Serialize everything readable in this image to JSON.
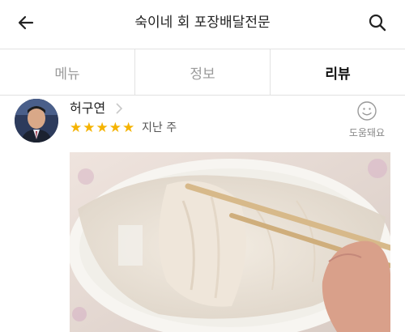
{
  "header": {
    "title": "숙이네 회 포장배달전문",
    "back_icon": "arrow-left-icon",
    "search_icon": "search-icon"
  },
  "tabs": [
    {
      "label": "메뉴",
      "active": false
    },
    {
      "label": "정보",
      "active": false
    },
    {
      "label": "리뷰",
      "active": true
    }
  ],
  "review": {
    "reviewer_name": "허구연",
    "rating": 5,
    "max_rating": 5,
    "time_ago": "지난 주",
    "helpful_label": "도움돼요",
    "helpful_icon": "smiley-icon",
    "photo_description_icon": "review-photo"
  },
  "colors": {
    "star": "#f5b301",
    "active_tab_text": "#111111",
    "inactive_tab_text": "#9a9a9a",
    "divider": "#e2e2e2"
  }
}
